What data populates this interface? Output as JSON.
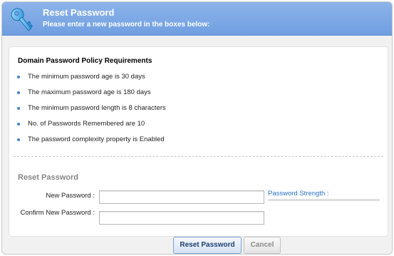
{
  "header": {
    "title": "Reset Password",
    "subtitle": "Please enter a new password in the boxes below:",
    "icon": "key-icon",
    "bg_color": "#7ca7e5"
  },
  "policy": {
    "title": "Domain Password Policy Requirements",
    "items": [
      {
        "label": "The minimum password age is 30 days"
      },
      {
        "label": "The maximum password age is 180 days"
      },
      {
        "label": "The minimum password length is 8 characters"
      },
      {
        "label": "No. of Passwords Remembered are 10"
      },
      {
        "label": "The password complexity property is Enabled"
      }
    ],
    "bullet_color": "#3f86cf"
  },
  "form": {
    "section_title": "Reset Password",
    "new_password_label": "New Password :",
    "new_password_value": "",
    "confirm_password_label": "Confirm New Password :",
    "confirm_password_value": "",
    "strength_label": "Password Strength :",
    "strength_color": "#2b6fc7"
  },
  "buttons": {
    "reset_label": "Reset Password",
    "cancel_label": "Cancel"
  }
}
